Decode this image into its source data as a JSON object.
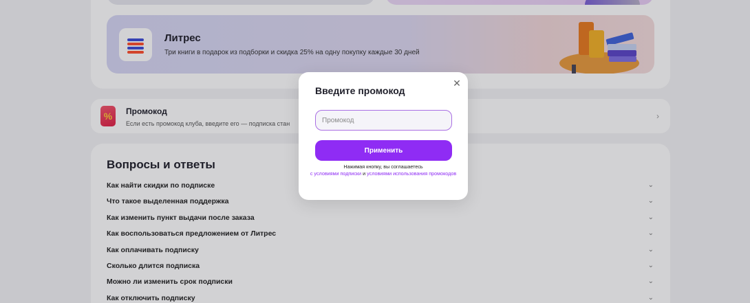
{
  "litres_offer": {
    "title": "Литрес",
    "description": "Три книги в подарок из подборки и скидка 25% на одну покупку каждые 30 дней",
    "logo_stripe_colors": [
      "#3d4ad6",
      "#ff4e2e",
      "#3d4ad6",
      "#ff4e2e"
    ]
  },
  "promo_row": {
    "title": "Промокод",
    "description": "Если есть промокод клуба, введите его — подписка стан",
    "icon_symbol": "%"
  },
  "faq": {
    "title": "Вопросы и ответы",
    "items": [
      "Как найти скидки по подписке",
      "Что такое выделенная поддержка",
      "Как изменить пункт выдачи после заказа",
      "Как воспользоваться предложением от Литрес",
      "Как оплачивать подписку",
      "Сколько длится подписка",
      "Можно ли изменить срок подписки",
      "Как отключить подписку"
    ]
  },
  "modal": {
    "title": "Введите промокод",
    "input_placeholder": "Промокод",
    "apply_label": "Применить",
    "terms_prefix": "Нажимая кнопку, вы соглашаетесь",
    "terms_link1": "с условиями подписки",
    "terms_and": "и",
    "terms_link2": "условиями использования промокодов"
  },
  "colors": {
    "accent": "#8f2cf4",
    "input_border": "#a96ee3",
    "overlay": "rgba(30,30,40,0.20)"
  },
  "icons": {
    "close": "close-icon",
    "chevron_down": "chevron-down-icon",
    "chevron_right": "chevron-right-icon"
  }
}
